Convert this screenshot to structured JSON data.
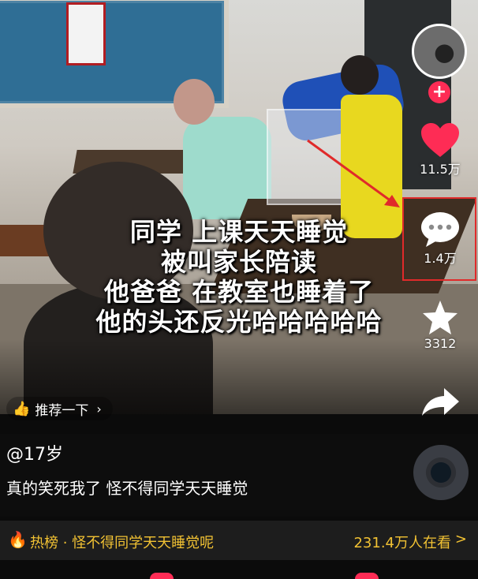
{
  "caption": {
    "lines": [
      "同学 上课天天睡觉",
      "被叫家长陪读",
      "他爸爸 在教室也睡着了",
      "他的头还反光哈哈哈哈哈"
    ]
  },
  "recommend": {
    "label": "推荐一下",
    "icon": "thumbs-up-icon"
  },
  "rail": {
    "likes": "11.5万",
    "comments": "1.4万",
    "favorites": "3312"
  },
  "info": {
    "author": "@17岁",
    "description": "真的笑死我了 怪不得同学天天睡觉"
  },
  "hot": {
    "label": "热榜 · 怪不得同学天天睡觉呢",
    "views": "231.4万人在看",
    "arrow": ">"
  },
  "colors": {
    "like": "#fe2c55",
    "highlight": "#e02a2a",
    "hot_text": "#f2c233"
  }
}
